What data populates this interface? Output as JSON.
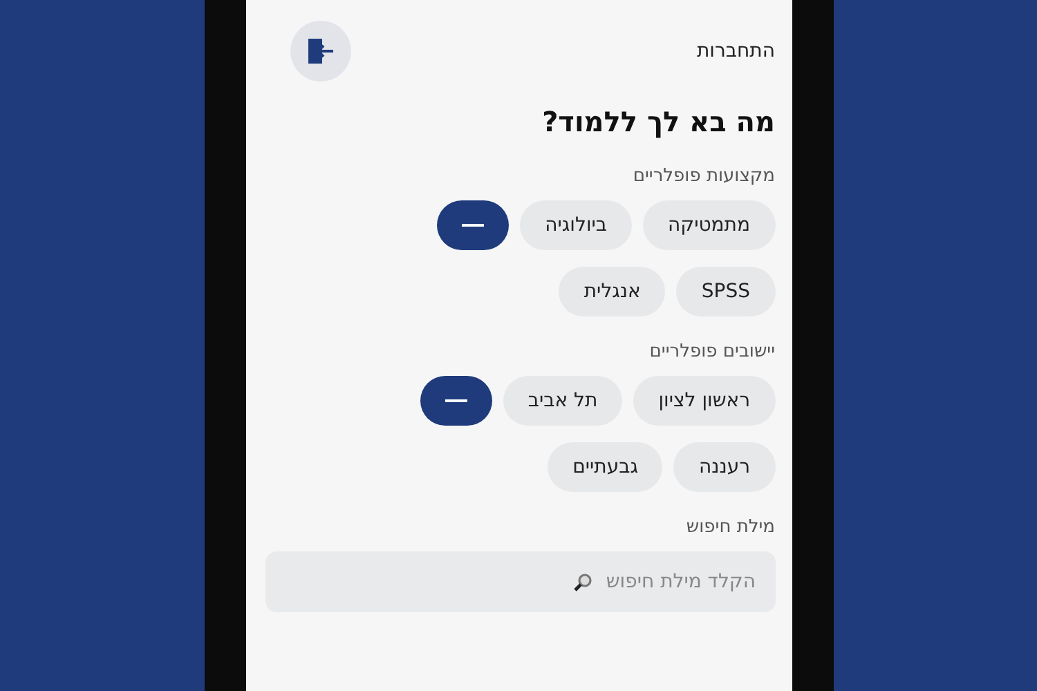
{
  "header": {
    "login_label": "התחברות"
  },
  "title": "מה בא לך ללמוד?",
  "groups": [
    {
      "label": "מקצועות פופלריים",
      "rows": [
        [
          "מתמטיקה",
          "ביולוגיה"
        ],
        [
          "SPSS",
          "אנגלית"
        ]
      ]
    },
    {
      "label": "יישובים פופלריים",
      "rows": [
        [
          "ראשון לציון",
          "תל אביב"
        ],
        [
          "רעננה",
          "גבעתיים"
        ]
      ]
    }
  ],
  "search": {
    "label": "מילת חיפוש",
    "placeholder": "הקלד מילת חיפוש"
  }
}
